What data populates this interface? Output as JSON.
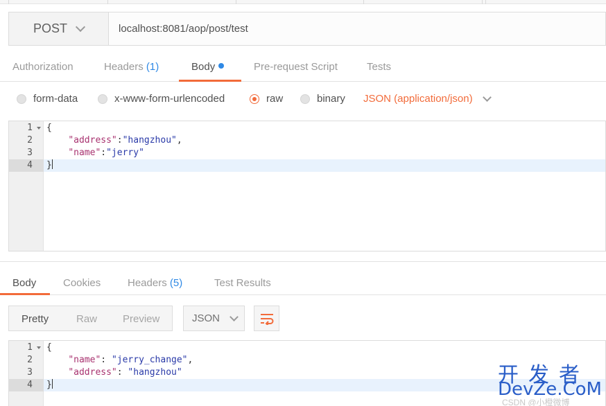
{
  "request": {
    "method": "POST",
    "url": "localhost:8081/aop/post/test"
  },
  "request_tabs": {
    "authorization": "Authorization",
    "headers": "Headers",
    "headers_count": "(1)",
    "body": "Body",
    "prerequest": "Pre-request Script",
    "tests": "Tests"
  },
  "body_options": {
    "form_data": "form-data",
    "urlencoded": "x-www-form-urlencoded",
    "raw": "raw",
    "binary": "binary",
    "content_type": "JSON (application/json)"
  },
  "request_body": {
    "line_numbers": [
      "1",
      "2",
      "3",
      "4"
    ],
    "open_brace": "{",
    "address_key": "\"address\"",
    "address_value": "\"hangzhou\"",
    "name_key": "\"name\"",
    "name_value": "\"jerry\"",
    "close_brace": "}"
  },
  "response_tabs": {
    "body": "Body",
    "cookies": "Cookies",
    "headers": "Headers",
    "headers_count": "(5)",
    "test_results": "Test Results"
  },
  "view_modes": {
    "pretty": "Pretty",
    "raw": "Raw",
    "preview": "Preview",
    "format": "JSON"
  },
  "response_body": {
    "line_numbers": [
      "1",
      "2",
      "3",
      "4"
    ],
    "open_brace": "{",
    "name_key": "\"name\"",
    "name_value": "\"jerry_change\"",
    "address_key": "\"address\"",
    "address_value": "\"hangzhou\"",
    "close_brace": "}"
  },
  "watermark": {
    "cn": "开发者",
    "en": "DevZe.CoM",
    "sub": "CSDN @小橙微博"
  },
  "colors": {
    "accent": "#f26b3a",
    "link": "#2f89e5",
    "json_key": "#a8326f",
    "json_string": "#2a3aa8"
  }
}
